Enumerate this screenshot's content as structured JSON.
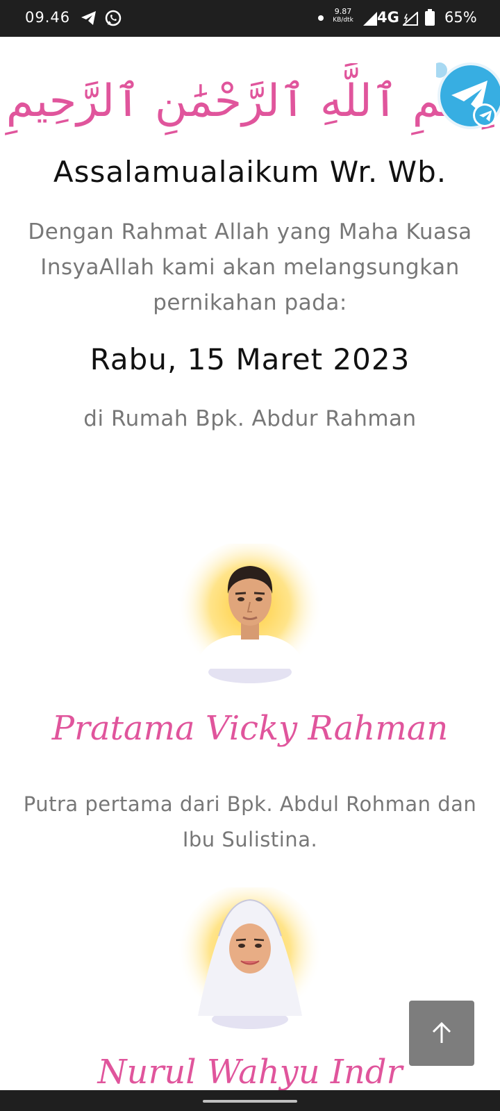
{
  "status_bar": {
    "time": "09.46",
    "speed_value": "9.87",
    "speed_unit": "KB/dtk",
    "network": "4G",
    "battery": "65%"
  },
  "invitation": {
    "bismillah": "بِسْمِ ٱللَّهِ ٱلرَّحْمَٰنِ ٱلرَّحِيمِ",
    "greeting": "Assalamualaikum Wr. Wb.",
    "intro_line1": "Dengan Rahmat Allah yang Maha Kuasa",
    "intro_line2": "InsyaAllah kami akan melangsungkan",
    "intro_line3": "pernikahan pada:",
    "date": "Rabu, 15 Maret 2023",
    "venue": "di Rumah Bpk. Abdur Rahman"
  },
  "groom": {
    "name": "Pratama Vicky Rahman",
    "desc_line1": "Putra pertama dari Bpk. Abdul Rohman dan",
    "desc_line2": "Ibu Sulistina."
  },
  "bride": {
    "name_partial": "Nurul Wahyu Indr"
  },
  "colors": {
    "accent_pink": "#e0559c",
    "text_gray": "#777777",
    "status_bar_bg": "#1f1f1f",
    "scroll_button_bg": "#7d7d7d",
    "telegram_blue": "#37aee2"
  },
  "icons": {
    "status": [
      "telegram-icon",
      "whatsapp-icon",
      "signal-icon",
      "battery-icon"
    ],
    "floating": "telegram-float-icon",
    "scroll": "arrow-up-icon"
  }
}
